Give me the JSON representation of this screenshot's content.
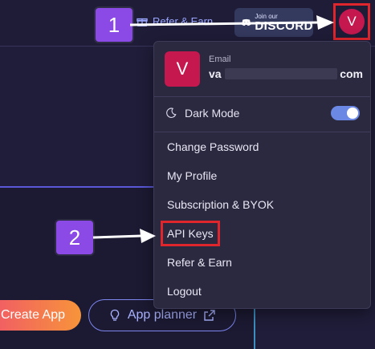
{
  "topbar": {
    "refer_label": "Refer & Earn",
    "discord_small": "Join our",
    "discord_big": "DISCORD",
    "avatar_initial": "V"
  },
  "dropdown": {
    "avatar_initial": "V",
    "email_label": "Email",
    "email_prefix": "va",
    "email_suffix": "com",
    "dark_mode_label": "Dark Mode",
    "dark_mode_on": true,
    "items": [
      {
        "label": "Change Password"
      },
      {
        "label": "My Profile"
      },
      {
        "label": "Subscription & BYOK"
      },
      {
        "label": "API Keys"
      },
      {
        "label": "Refer & Earn"
      },
      {
        "label": "Logout"
      }
    ]
  },
  "main": {
    "create_app_label": "Create App",
    "app_planner_label": "App planner"
  },
  "annotations": {
    "step1": "1",
    "step2": "2"
  },
  "colors": {
    "accent": "#6b88e4",
    "avatar": "#c4184f",
    "highlight_box": "#e0262d",
    "badge": "#8b4ae6"
  }
}
